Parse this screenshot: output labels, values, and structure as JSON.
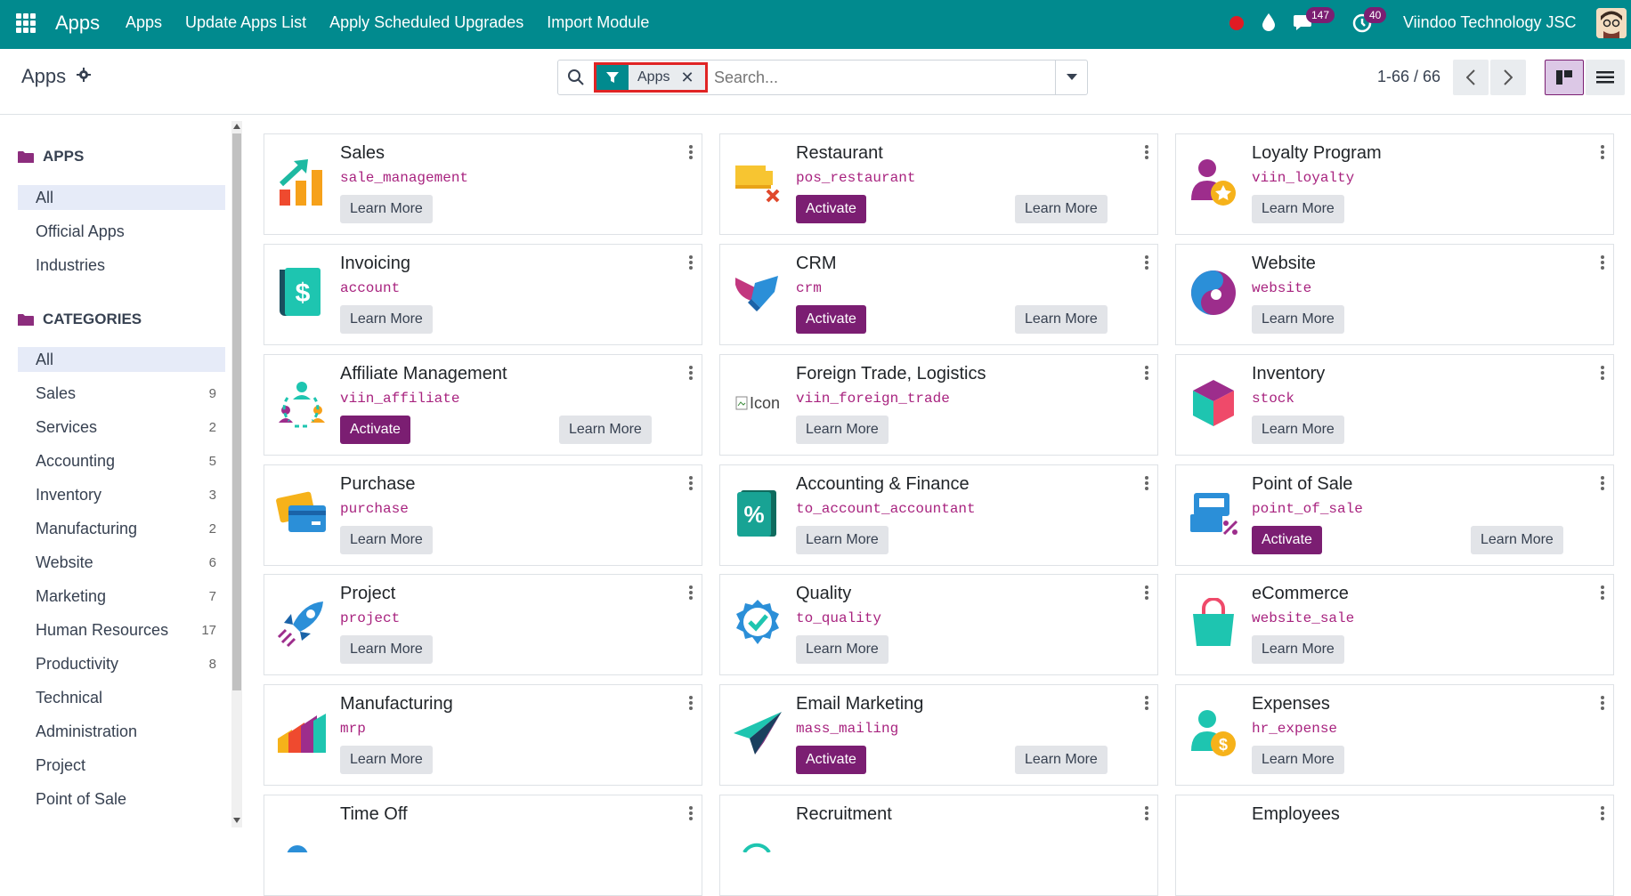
{
  "topbar": {
    "brand": "Apps",
    "menu": [
      "Apps",
      "Update Apps List",
      "Apply Scheduled Upgrades",
      "Import Module"
    ],
    "messages_count": "147",
    "activities_count": "40",
    "company": "Viindoo Technology JSC",
    "color": "#018a8e"
  },
  "control_panel": {
    "title": "Apps",
    "facet_label": "Apps",
    "search_placeholder": "Search...",
    "pager": "1-66 / 66"
  },
  "sidebar": {
    "apps_heading": "APPS",
    "apps_items": [
      "All",
      "Official Apps",
      "Industries"
    ],
    "categories_heading": "CATEGORIES",
    "categories": [
      {
        "label": "All",
        "count": ""
      },
      {
        "label": "Sales",
        "count": "9"
      },
      {
        "label": "Services",
        "count": "2"
      },
      {
        "label": "Accounting",
        "count": "5"
      },
      {
        "label": "Inventory",
        "count": "3"
      },
      {
        "label": "Manufacturing",
        "count": "2"
      },
      {
        "label": "Website",
        "count": "6"
      },
      {
        "label": "Marketing",
        "count": "7"
      },
      {
        "label": "Human Resources",
        "count": "17"
      },
      {
        "label": "Productivity",
        "count": "8"
      },
      {
        "label": "Technical",
        "count": ""
      },
      {
        "label": "Administration",
        "count": ""
      },
      {
        "label": "Project",
        "count": ""
      },
      {
        "label": "Point of Sale",
        "count": ""
      }
    ]
  },
  "buttons": {
    "activate": "Activate",
    "learn_more": "Learn More"
  },
  "broken_icon_alt": "Icon",
  "cards": [
    {
      "name": "Sales",
      "tech": "sale_management",
      "activate": false,
      "icon": "sales-chart-icon"
    },
    {
      "name": "Restaurant",
      "tech": "pos_restaurant",
      "activate": true,
      "icon": "restaurant-icon"
    },
    {
      "name": "Loyalty Program",
      "tech": "viin_loyalty",
      "activate": false,
      "icon": "loyalty-icon"
    },
    {
      "name": "Invoicing",
      "tech": "account",
      "activate": false,
      "icon": "invoice-icon"
    },
    {
      "name": "CRM",
      "tech": "crm",
      "activate": true,
      "icon": "crm-icon"
    },
    {
      "name": "Website",
      "tech": "website",
      "activate": false,
      "icon": "website-icon"
    },
    {
      "name": "Affiliate Management",
      "tech": "viin_affiliate",
      "activate": true,
      "icon": "affiliate-icon"
    },
    {
      "name": "Foreign Trade, Logistics",
      "tech": "viin_foreign_trade",
      "activate": false,
      "icon": "broken-image-icon"
    },
    {
      "name": "Inventory",
      "tech": "stock",
      "activate": false,
      "icon": "inventory-cube-icon"
    },
    {
      "name": "Purchase",
      "tech": "purchase",
      "activate": false,
      "icon": "purchase-cards-icon"
    },
    {
      "name": "Accounting & Finance",
      "tech": "to_account_accountant",
      "activate": false,
      "icon": "accounting-icon"
    },
    {
      "name": "Point of Sale",
      "tech": "point_of_sale",
      "activate": true,
      "icon": "pos-icon"
    },
    {
      "name": "Project",
      "tech": "project",
      "activate": false,
      "icon": "rocket-icon"
    },
    {
      "name": "Quality",
      "tech": "to_quality",
      "activate": false,
      "icon": "quality-badge-icon"
    },
    {
      "name": "eCommerce",
      "tech": "website_sale",
      "activate": false,
      "icon": "shopping-bag-icon"
    },
    {
      "name": "Manufacturing",
      "tech": "mrp",
      "activate": false,
      "icon": "manufacturing-icon"
    },
    {
      "name": "Email Marketing",
      "tech": "mass_mailing",
      "activate": true,
      "icon": "paper-plane-icon"
    },
    {
      "name": "Expenses",
      "tech": "hr_expense",
      "activate": false,
      "icon": "expense-icon"
    },
    {
      "name": "Time Off",
      "tech": "",
      "activate": false,
      "icon": "time-off-icon"
    },
    {
      "name": "Recruitment",
      "tech": "",
      "activate": false,
      "icon": "recruitment-icon"
    },
    {
      "name": "Employees",
      "tech": "",
      "activate": false,
      "icon": "employees-icon"
    }
  ]
}
